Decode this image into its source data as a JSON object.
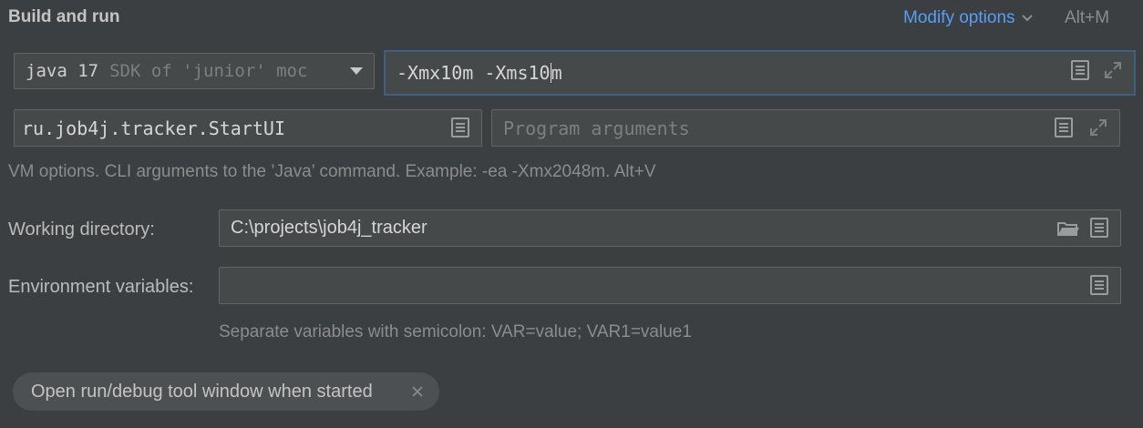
{
  "section": {
    "title": "Build and run",
    "modify_options_label": "Modify options",
    "modify_options_shortcut": "Alt+M"
  },
  "jdk_select": {
    "version": "java 17",
    "hint": "SDK of 'junior' moc"
  },
  "vm_options": {
    "value_before_caret": "-Xmx10m -Xms10",
    "value_after_caret": "m"
  },
  "main_class": {
    "value": "ru.job4j.tracker.StartUI"
  },
  "program_arguments": {
    "placeholder": "Program arguments"
  },
  "vm_help": "VM options. CLI arguments to the ’Java’ command. Example: -ea -Xmx2048m. Alt+V",
  "working_directory": {
    "label": "Working directory:",
    "value": "C:\\projects\\job4j_tracker"
  },
  "environment_variables": {
    "label": "Environment variables:",
    "value": "",
    "hint": "Separate variables with semicolon: VAR=value; VAR1=value1"
  },
  "option_chip": {
    "label": "Open run/debug tool window when started"
  },
  "colors": {
    "background": "#3c3f41",
    "field": "#45494a",
    "focus_border": "#3d6185",
    "link": "#589df6"
  }
}
